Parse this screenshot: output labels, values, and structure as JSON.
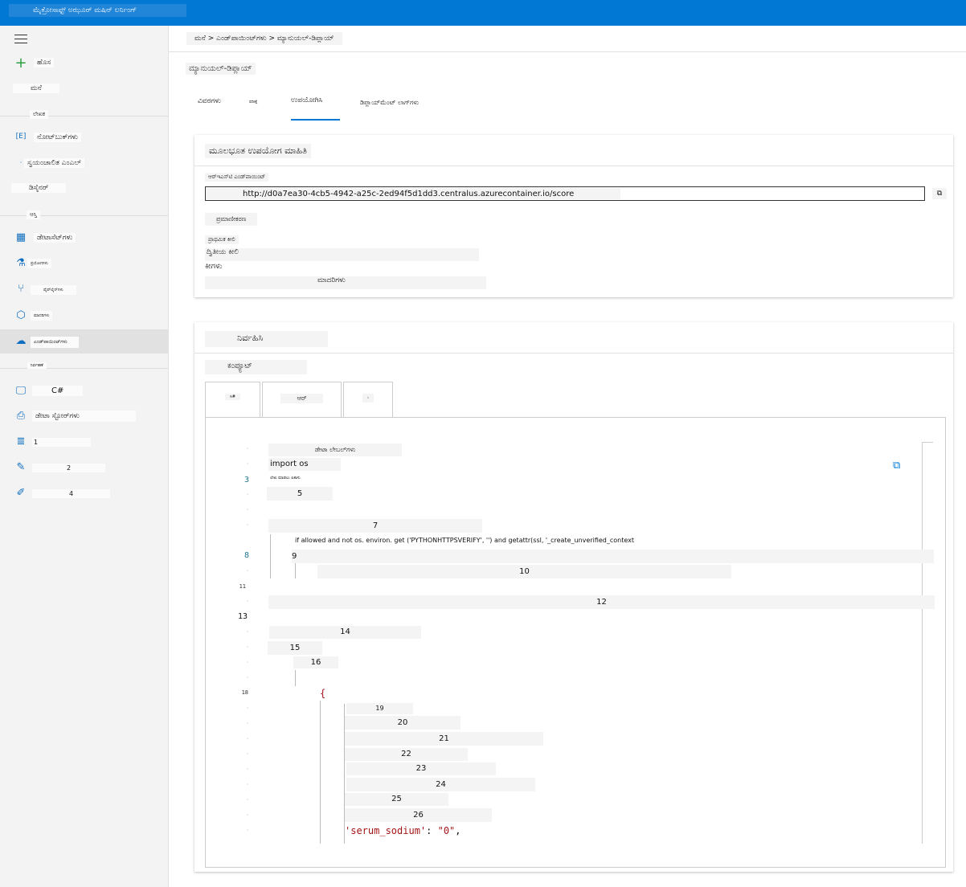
{
  "app": {
    "title": "ಮೈಕ್ರೋಸಾಫ್ಟ್ ಅಝೂರ್ ಮಷಿನ್ ಲರ್ನಿಂಗ್"
  },
  "sidebar": {
    "new_label": "ಹೊಸ",
    "home_label": "ಮನೆ",
    "section_author": "ಲೇಖಕ",
    "notebooks": "ನೋಟ್‌ಬುಕ್‌ಗಳು",
    "automl": "ಸ್ವಯಂಚಾಲಿತ ಎಂಎಲ್",
    "designer": "ಡಿಸೈನರ್",
    "section_assets": "ಆಸ್ತಿ",
    "datasets": "ಡೇಟಾಸೆಟ್‌ಗಳು",
    "experiments": "ಪ್ರಯೋಗಗಳು",
    "pipelines": "ಪೈಪ್‌ಲೈನ್‌ಗಳು",
    "models": "ಮಾದರಿಗಳು",
    "endpoints": "ಎಂಡ್‌ಪಾಯಿಂಟ್‌ಗಳು",
    "section_manage": "ನಿರ್ವಹಣೆ",
    "compute": "C#",
    "datastores": "ಡೇಟಾ ಸ್ಟೋರ್‌ಗಳು",
    "item1": "1",
    "item2": "2",
    "item4": "4"
  },
  "breadcrumb": "ಮನೆ > ಎಂಡ್‌ಪಾಯಿಂಟ್‌ಗಳು > ಮ್ಯಾನುಯಲ್-ಡಿಪ್ಲಾಯ್",
  "page": {
    "title": "ಮ್ಯಾನುಯಲ್-ಡಿಪ್ಲಾಯ್"
  },
  "tabs": {
    "details": "ವಿವರಗಳು",
    "test": "ಪರೀಕ್ಷೆ",
    "consume": "ಉಪಯೋಗಿಸಿ",
    "logs": "ಡಿಪ್ಲಾಯ್‌ಮೆಂಟ್ ಲಾಗ್‌ಗಳು"
  },
  "basic": {
    "header": "ಮೂಲಭೂತ ಉಪಯೋಗ ಮಾಹಿತಿ",
    "rest_label": "ಆರ್‌ಇಎಸ್‌ಟಿ ಎಂಡ್‌ಪಾಯಿಂಟ್",
    "rest_url": "http://d0a7ea30-4cb5-4942-a25c-2ed94f5d1dd3.centralus.azurecontainer.io/score",
    "copy": "⧉",
    "auth": "ಪ್ರಮಾಣೀಕರಣ",
    "primary_key_label": "ಪ್ರಾಥಮಿಕ ಕೀಲಿ",
    "secondary_key": "ದ್ವಿತೀಯ ಕೀಲಿ",
    "keys": "ಕೀಗಳು",
    "models": "ಮಾದರಿಗಳು"
  },
  "consume": {
    "header": "ನಿರ್ವಹಿಸಿ",
    "sub": "ಕಂಪ್ಯೂಟ್",
    "code_tabs": [
      "ಸಿ#",
      "ಆರ್",
      "·"
    ],
    "code_title": "ಡೇಟಾ ಲೇಬಲ್‌ಗಳು",
    "import_line": "import os",
    "line3_text": "ಲೇಖ ಮಾಡಲು ಪಿಕಾಸು",
    "num3": "3",
    "num5": "5",
    "num7": "7",
    "ssl_line": "if allowed and not os. environ. get ('PYTHONHTTPSVERIFY', '') and getattr(ssl, '_create_unverified_context",
    "num8": "8",
    "num9": "9",
    "num10": "10",
    "num11": "11",
    "num12": "12",
    "num13": "13",
    "num14": "14",
    "num15": "15",
    "num16": "16",
    "num18": "18",
    "brace": "{",
    "num19": "19",
    "num20": "20",
    "num21": "21",
    "num22": "22",
    "num23": "23",
    "num24": "24",
    "num25": "25",
    "num26": "26",
    "serum_key": "'serum_sodium'",
    "serum_sep": ": ",
    "serum_val": "\"0\"",
    "serum_comma": ","
  }
}
